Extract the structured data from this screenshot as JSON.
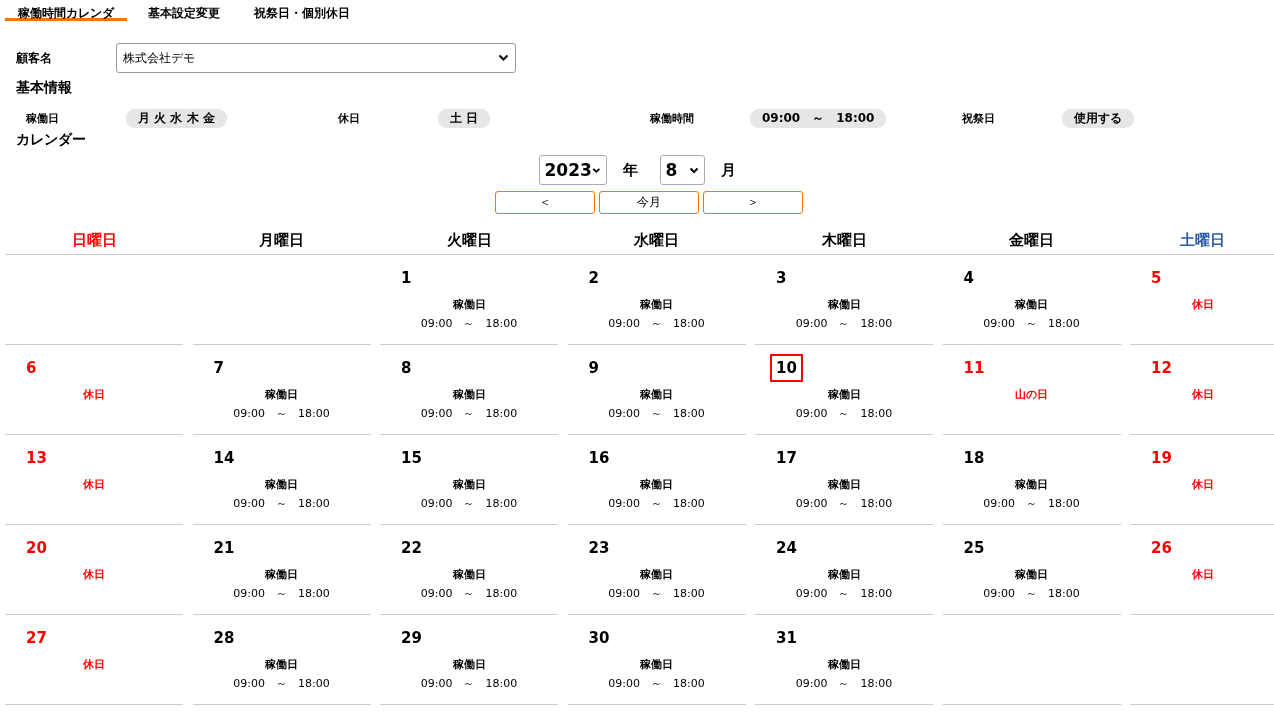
{
  "tabs": [
    {
      "label": "稼働時間カレンダ",
      "selected": true
    },
    {
      "label": "基本設定変更",
      "selected": false
    },
    {
      "label": "祝祭日・個別休日",
      "selected": false
    }
  ],
  "customer": {
    "label": "顧客名",
    "value": "株式会社デモ"
  },
  "basic_info": {
    "title": "基本情報",
    "items": [
      {
        "label": "稼働日",
        "value": "月 火 水 木 金"
      },
      {
        "label": "休日",
        "value": "土 日"
      },
      {
        "label": "稼働時間",
        "value": "09:00　～　18:00"
      },
      {
        "label": "祝祭日",
        "value": "使用する"
      }
    ]
  },
  "calendar": {
    "title": "カレンダー",
    "year": "2023",
    "year_unit": "年",
    "month": "8",
    "month_unit": "月",
    "nav": [
      "＜",
      "今月",
      "＞"
    ],
    "weekdays": [
      {
        "label": "日曜日",
        "color": "#ff0000"
      },
      {
        "label": "月曜日",
        "color": "#000000"
      },
      {
        "label": "火曜日",
        "color": "#000000"
      },
      {
        "label": "水曜日",
        "color": "#000000"
      },
      {
        "label": "木曜日",
        "color": "#000000"
      },
      {
        "label": "金曜日",
        "color": "#000000"
      },
      {
        "label": "土曜日",
        "color": "#2a5caa"
      }
    ],
    "weeks": [
      {
        "days": [
          {
            "kind": "empty"
          },
          {
            "kind": "empty"
          },
          {
            "kind": "work",
            "day": "1",
            "label": "稼働日",
            "hours": "09:00　～　18:00",
            "today": false
          },
          {
            "kind": "work",
            "day": "2",
            "label": "稼働日",
            "hours": "09:00　～　18:00",
            "today": false
          },
          {
            "kind": "work",
            "day": "3",
            "label": "稼働日",
            "hours": "09:00　～　18:00",
            "today": false
          },
          {
            "kind": "work",
            "day": "4",
            "label": "稼働日",
            "hours": "09:00　～　18:00",
            "today": false
          },
          {
            "kind": "off",
            "day": "5",
            "label": "休日",
            "today": false
          }
        ]
      },
      {
        "days": [
          {
            "kind": "off",
            "day": "6",
            "label": "休日",
            "today": false
          },
          {
            "kind": "work",
            "day": "7",
            "label": "稼働日",
            "hours": "09:00　～　18:00",
            "today": false
          },
          {
            "kind": "work",
            "day": "8",
            "label": "稼働日",
            "hours": "09:00　～　18:00",
            "today": false
          },
          {
            "kind": "work",
            "day": "9",
            "label": "稼働日",
            "hours": "09:00　～　18:00",
            "today": false
          },
          {
            "kind": "work",
            "day": "10",
            "label": "稼働日",
            "hours": "09:00　～　18:00",
            "today": true
          },
          {
            "kind": "off",
            "day": "11",
            "label": "山の日",
            "today": false
          },
          {
            "kind": "off",
            "day": "12",
            "label": "休日",
            "today": false
          }
        ]
      },
      {
        "days": [
          {
            "kind": "off",
            "day": "13",
            "label": "休日",
            "today": false
          },
          {
            "kind": "work",
            "day": "14",
            "label": "稼働日",
            "hours": "09:00　～　18:00",
            "today": false
          },
          {
            "kind": "work",
            "day": "15",
            "label": "稼働日",
            "hours": "09:00　～　18:00",
            "today": false
          },
          {
            "kind": "work",
            "day": "16",
            "label": "稼働日",
            "hours": "09:00　～　18:00",
            "today": false
          },
          {
            "kind": "work",
            "day": "17",
            "label": "稼働日",
            "hours": "09:00　～　18:00",
            "today": false
          },
          {
            "kind": "work",
            "day": "18",
            "label": "稼働日",
            "hours": "09:00　～　18:00",
            "today": false
          },
          {
            "kind": "off",
            "day": "19",
            "label": "休日",
            "today": false
          }
        ]
      },
      {
        "days": [
          {
            "kind": "off",
            "day": "20",
            "label": "休日",
            "today": false
          },
          {
            "kind": "work",
            "day": "21",
            "label": "稼働日",
            "hours": "09:00　～　18:00",
            "today": false
          },
          {
            "kind": "work",
            "day": "22",
            "label": "稼働日",
            "hours": "09:00　～　18:00",
            "today": false
          },
          {
            "kind": "work",
            "day": "23",
            "label": "稼働日",
            "hours": "09:00　～　18:00",
            "today": false
          },
          {
            "kind": "work",
            "day": "24",
            "label": "稼働日",
            "hours": "09:00　～　18:00",
            "today": false
          },
          {
            "kind": "work",
            "day": "25",
            "label": "稼働日",
            "hours": "09:00　～　18:00",
            "today": false
          },
          {
            "kind": "off",
            "day": "26",
            "label": "休日",
            "today": false
          }
        ]
      },
      {
        "days": [
          {
            "kind": "off",
            "day": "27",
            "label": "休日",
            "today": false
          },
          {
            "kind": "work",
            "day": "28",
            "label": "稼働日",
            "hours": "09:00　～　18:00",
            "today": false
          },
          {
            "kind": "work",
            "day": "29",
            "label": "稼働日",
            "hours": "09:00　～　18:00",
            "today": false
          },
          {
            "kind": "work",
            "day": "30",
            "label": "稼働日",
            "hours": "09:00　～　18:00",
            "today": false
          },
          {
            "kind": "work",
            "day": "31",
            "label": "稼働日",
            "hours": "09:00　～　18:00",
            "today": false
          },
          {
            "kind": "empty"
          },
          {
            "kind": "empty"
          }
        ]
      }
    ]
  }
}
